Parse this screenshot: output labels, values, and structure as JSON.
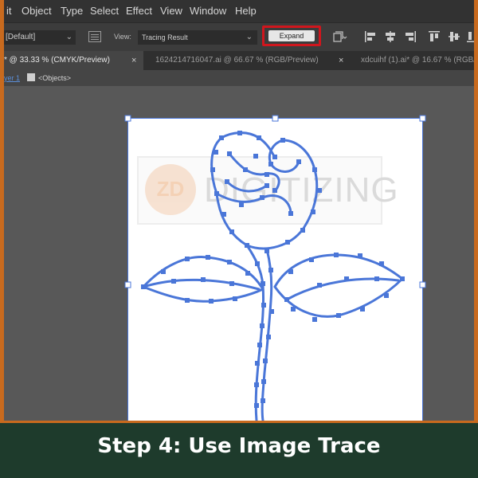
{
  "menubar": {
    "items": [
      "it",
      "Object",
      "Type",
      "Select",
      "Effect",
      "View",
      "Window",
      "Help"
    ]
  },
  "controlbar": {
    "preset_value": "[Default]",
    "view_label": "View:",
    "view_value": "Tracing Result",
    "expand_label": "Expand"
  },
  "tabs": [
    {
      "label": "* @ 33.33 % (CMYK/Preview)",
      "active": true
    },
    {
      "label": "1624214716047.ai @ 66.67 % (RGB/Preview)",
      "active": false
    },
    {
      "label": "xdcuihf (1).ai* @ 16.67 % (RGB/",
      "active": false
    }
  ],
  "tab_close_glyph": "×",
  "breadcrumb": {
    "layer": "yer 1",
    "context": "<Objects>"
  },
  "watermark": {
    "badge": "ZD",
    "text": "DIGITIZING"
  },
  "caption": "Step 4: Use Image Trace",
  "colors": {
    "frame": "#c86a1e",
    "caption_bg": "#1e3b2c",
    "selection": "#4a76d8",
    "highlight": "#d0161d"
  }
}
